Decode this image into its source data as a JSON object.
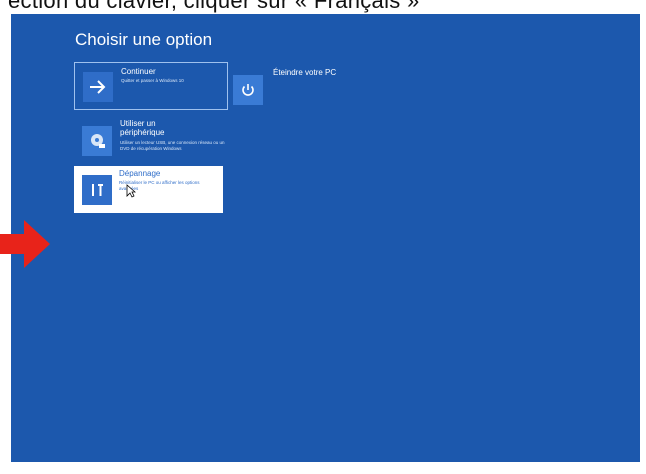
{
  "caption_text": "ection du clavier, cliquer sur « Français »",
  "screen": {
    "title": "Choisir une option",
    "background_color": "#1c58ad",
    "tiles": {
      "continue": {
        "label": "Continuer",
        "description": "Quitter et passer à Windows 10",
        "icon": "arrow-right-icon"
      },
      "shutdown": {
        "label": "Éteindre votre PC",
        "icon": "power-icon"
      },
      "device": {
        "label_line1": "Utiliser un",
        "label_line2": "périphérique",
        "description": "Utiliser un lecteur USB, une connexion réseau ou un DVD de récupération Windows",
        "icon": "disc-drive-icon"
      },
      "troubleshoot": {
        "label": "Dépannage",
        "description": "Réinitialiser le PC ou afficher les options avancées",
        "icon": "tools-icon"
      }
    }
  },
  "pointer_icon": "mouse-cursor-icon",
  "annotation": {
    "icon": "red-arrow-icon",
    "color": "#e8231a"
  }
}
